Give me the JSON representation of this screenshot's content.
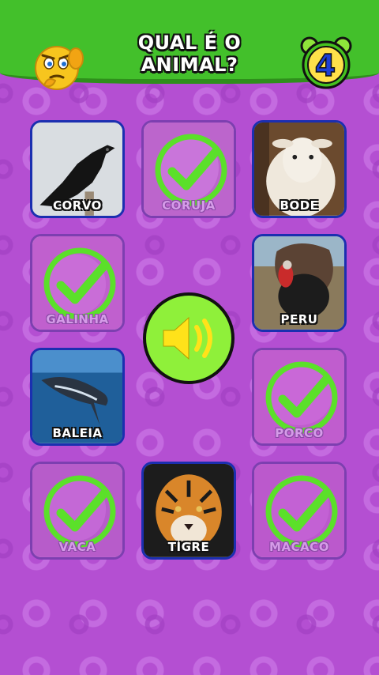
{
  "header": {
    "title_line1": "QUAL É O",
    "title_line2": "ANIMAL?",
    "counter": "4"
  },
  "tiles": [
    {
      "label": "CORVO",
      "answered": false
    },
    {
      "label": "CORUJA",
      "answered": true
    },
    {
      "label": "BODE",
      "answered": false
    },
    {
      "label": "GALINHA",
      "answered": true
    },
    {
      "label": "PERU",
      "answered": false
    },
    {
      "label": "BALEIA",
      "answered": false
    },
    {
      "label": "PORCO",
      "answered": true
    },
    {
      "label": "VACA",
      "answered": true
    },
    {
      "label": "TIGRE",
      "answered": false
    },
    {
      "label": "MACACO",
      "answered": true
    }
  ],
  "colors": {
    "background": "#b44fd2",
    "header": "#43c02b",
    "tile_border": "#1b2fb0",
    "check": "#5be02a",
    "sound_button": "#8ff03a"
  },
  "icons": {
    "emoji": "thinking-face-icon",
    "timer": "alarm-clock-icon",
    "sound": "speaker-icon",
    "answered": "checkmark-icon"
  }
}
